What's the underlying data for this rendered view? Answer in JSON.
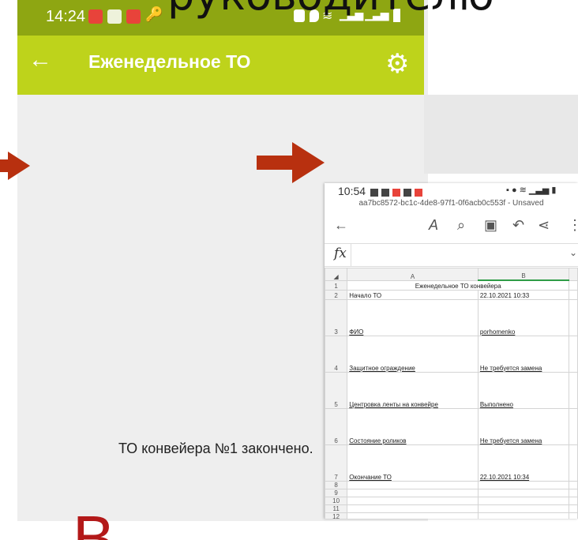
{
  "overlay_text": "руководителю",
  "phone1": {
    "status_time": "14:24",
    "appbar_title": "Еженедельное ТО",
    "message": "ТО конвейера №1 закончено."
  },
  "big_red_letter": "В",
  "phone2": {
    "status_time": "10:54",
    "document_name": "aa7bc8572-bc1c-4de8-97f1-0f6acb0c553f - Unsaved",
    "formula_label": "fx",
    "columns": [
      "A",
      "B"
    ],
    "rows": [
      {
        "num": "1",
        "a": "Еженедельное ТО конвейера",
        "b": ""
      },
      {
        "num": "2",
        "a": "Начало ТО",
        "b": "22.10.2021 10:33"
      },
      {
        "num": "3",
        "a": "ФИО",
        "b": "porhomenko"
      },
      {
        "num": "4",
        "a": "Защитное ограждение",
        "b": "Не требуется замена"
      },
      {
        "num": "5",
        "a": "Центровка ленты на конвейре",
        "b": "Выполнено"
      },
      {
        "num": "6",
        "a": "Состояние роликов",
        "b": "Не требуется замена"
      },
      {
        "num": "7",
        "a": "Окончание ТО",
        "b": "22.10.2021 10:34"
      },
      {
        "num": "8",
        "a": "",
        "b": ""
      },
      {
        "num": "9",
        "a": "",
        "b": ""
      },
      {
        "num": "10",
        "a": "",
        "b": ""
      },
      {
        "num": "11",
        "a": "",
        "b": ""
      },
      {
        "num": "12",
        "a": "",
        "b": ""
      }
    ]
  },
  "colors": {
    "status_bar": "#8ea612",
    "app_bar": "#bed31b",
    "arrow": "#b8300f",
    "selection": "#2f9c47"
  }
}
